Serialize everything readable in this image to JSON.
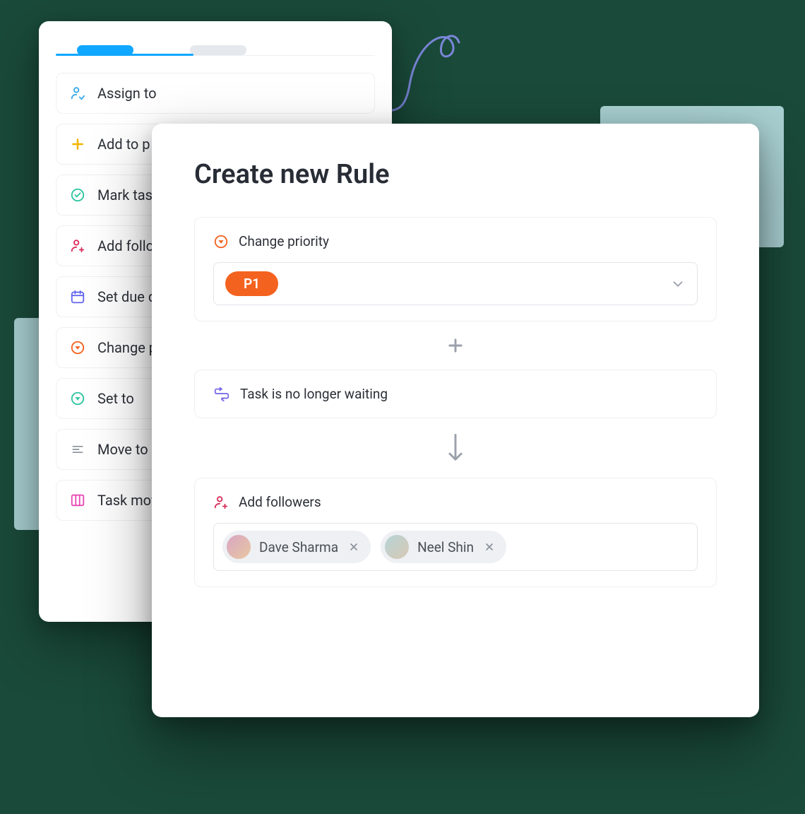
{
  "back_card": {
    "actions": [
      {
        "label": "Assign to",
        "icon": "assign"
      },
      {
        "label": "Add to p",
        "icon": "plus-yellow"
      },
      {
        "label": "Mark tas",
        "icon": "check-teal"
      },
      {
        "label": "Add follo",
        "icon": "follower-red"
      },
      {
        "label": "Set due d",
        "icon": "calendar-purple"
      },
      {
        "label": "Change p",
        "icon": "priority-orange"
      },
      {
        "label": "Set to",
        "icon": "dropdown-teal"
      },
      {
        "label": "Move to",
        "icon": "lines-gray"
      },
      {
        "label": "Task mov",
        "icon": "board-pink"
      }
    ]
  },
  "front_card": {
    "title": "Create new Rule",
    "change_priority": {
      "label": "Change priority",
      "selected": "P1"
    },
    "waiting": {
      "label": "Task is no longer waiting"
    },
    "add_followers": {
      "label": "Add followers",
      "followers": [
        {
          "name": "Dave Sharma"
        },
        {
          "name": "Neel Shin"
        }
      ]
    }
  }
}
